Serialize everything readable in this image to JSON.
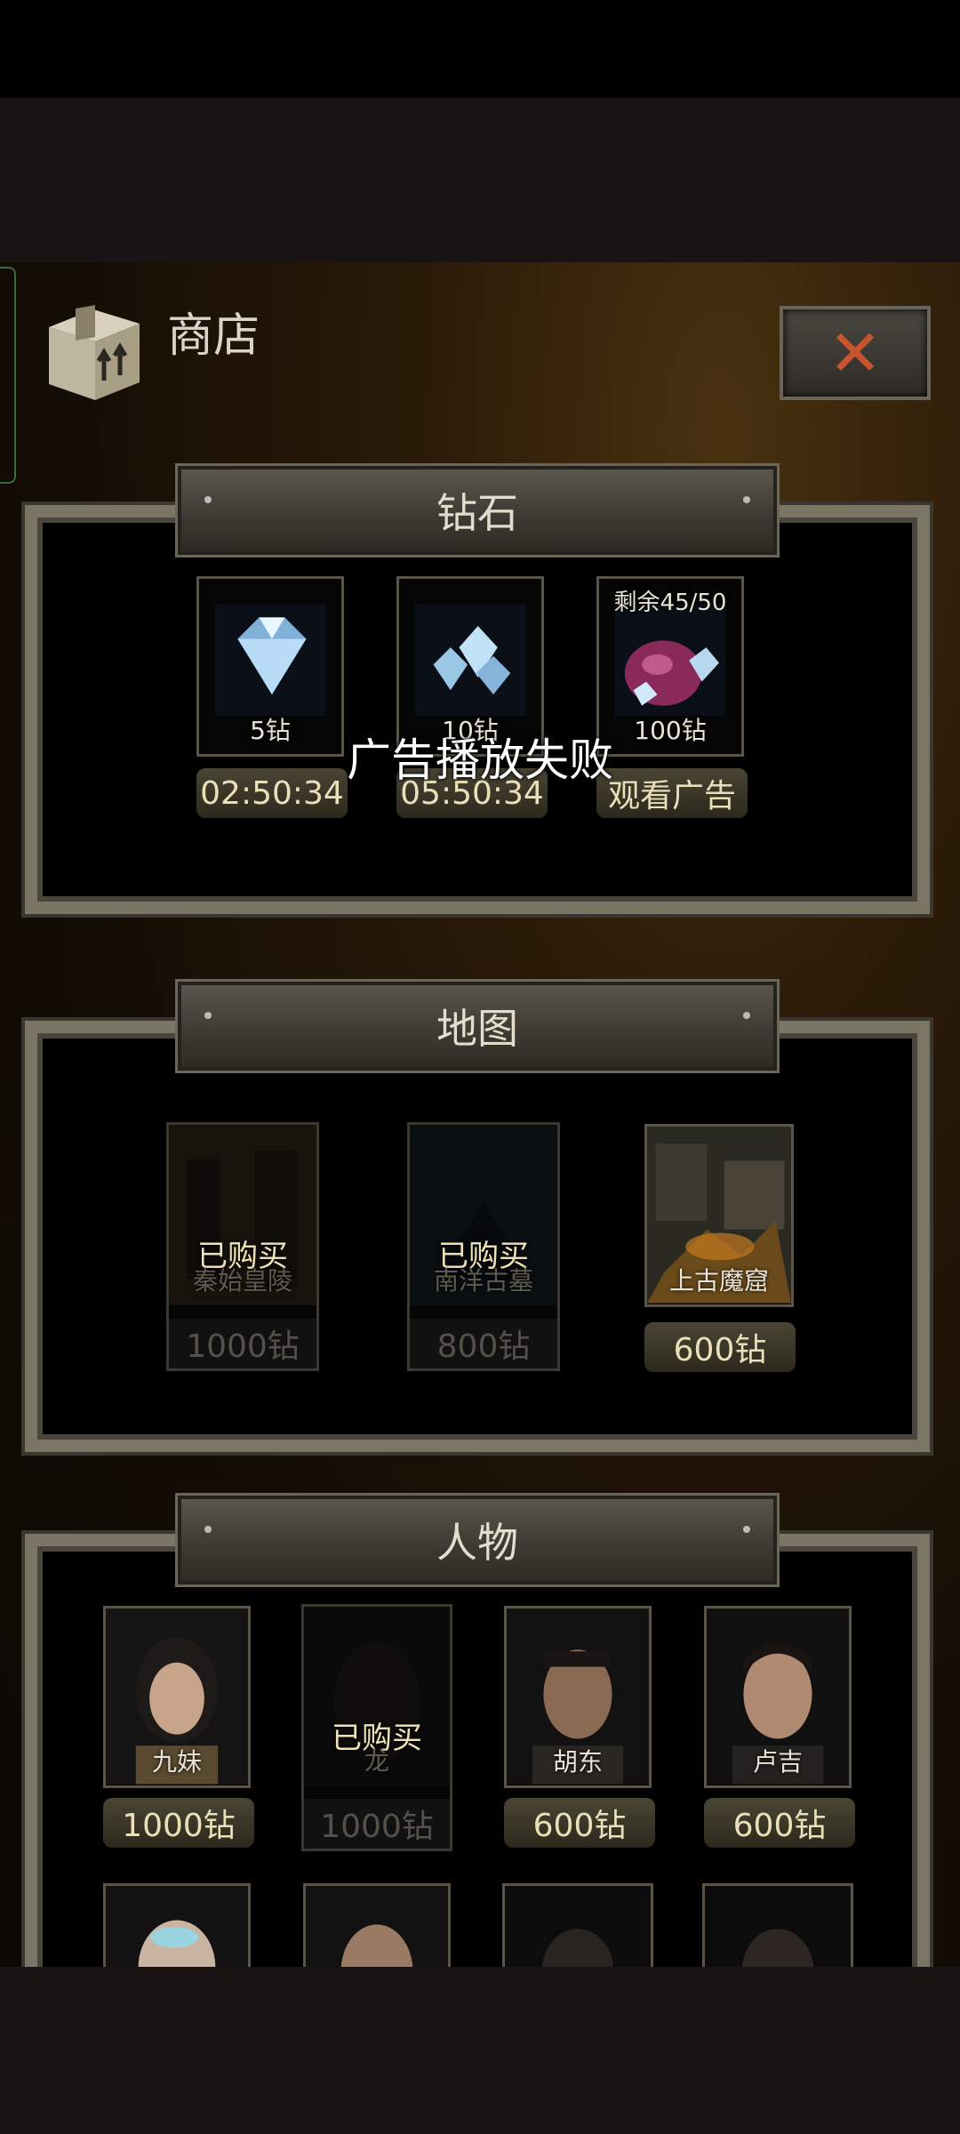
{
  "header": {
    "title": "商店"
  },
  "close_button": {
    "glyph": "✕"
  },
  "diamond_section": {
    "title": "钻石",
    "items": [
      {
        "label": "5钻",
        "button": "02:50:34",
        "icon": "diamond-icon"
      },
      {
        "label": "10钻",
        "button": "05:50:34",
        "icon": "diamond-pile-icon"
      },
      {
        "label": "100钻",
        "button": "观看广告",
        "remaining": "剩余45/50",
        "icon": "diamond-bag-icon"
      }
    ]
  },
  "toast": "广告播放失败",
  "map_section": {
    "title": "地图",
    "items": [
      {
        "label": "秦始皇陵",
        "price": "1000钻",
        "status": "已购买"
      },
      {
        "label": "南洋古墓",
        "price": "800钻",
        "status": "已购买"
      },
      {
        "label": "上古魔窟",
        "price": "600钻",
        "status": ""
      }
    ]
  },
  "character_section": {
    "title": "人物",
    "items": [
      {
        "label": "九妹",
        "price": "1000钻",
        "status": ""
      },
      {
        "label": "龙",
        "price": "1000钻",
        "status": "已购买"
      },
      {
        "label": "胡东",
        "price": "600钻",
        "status": ""
      },
      {
        "label": "卢吉",
        "price": "600钻",
        "status": ""
      }
    ]
  }
}
